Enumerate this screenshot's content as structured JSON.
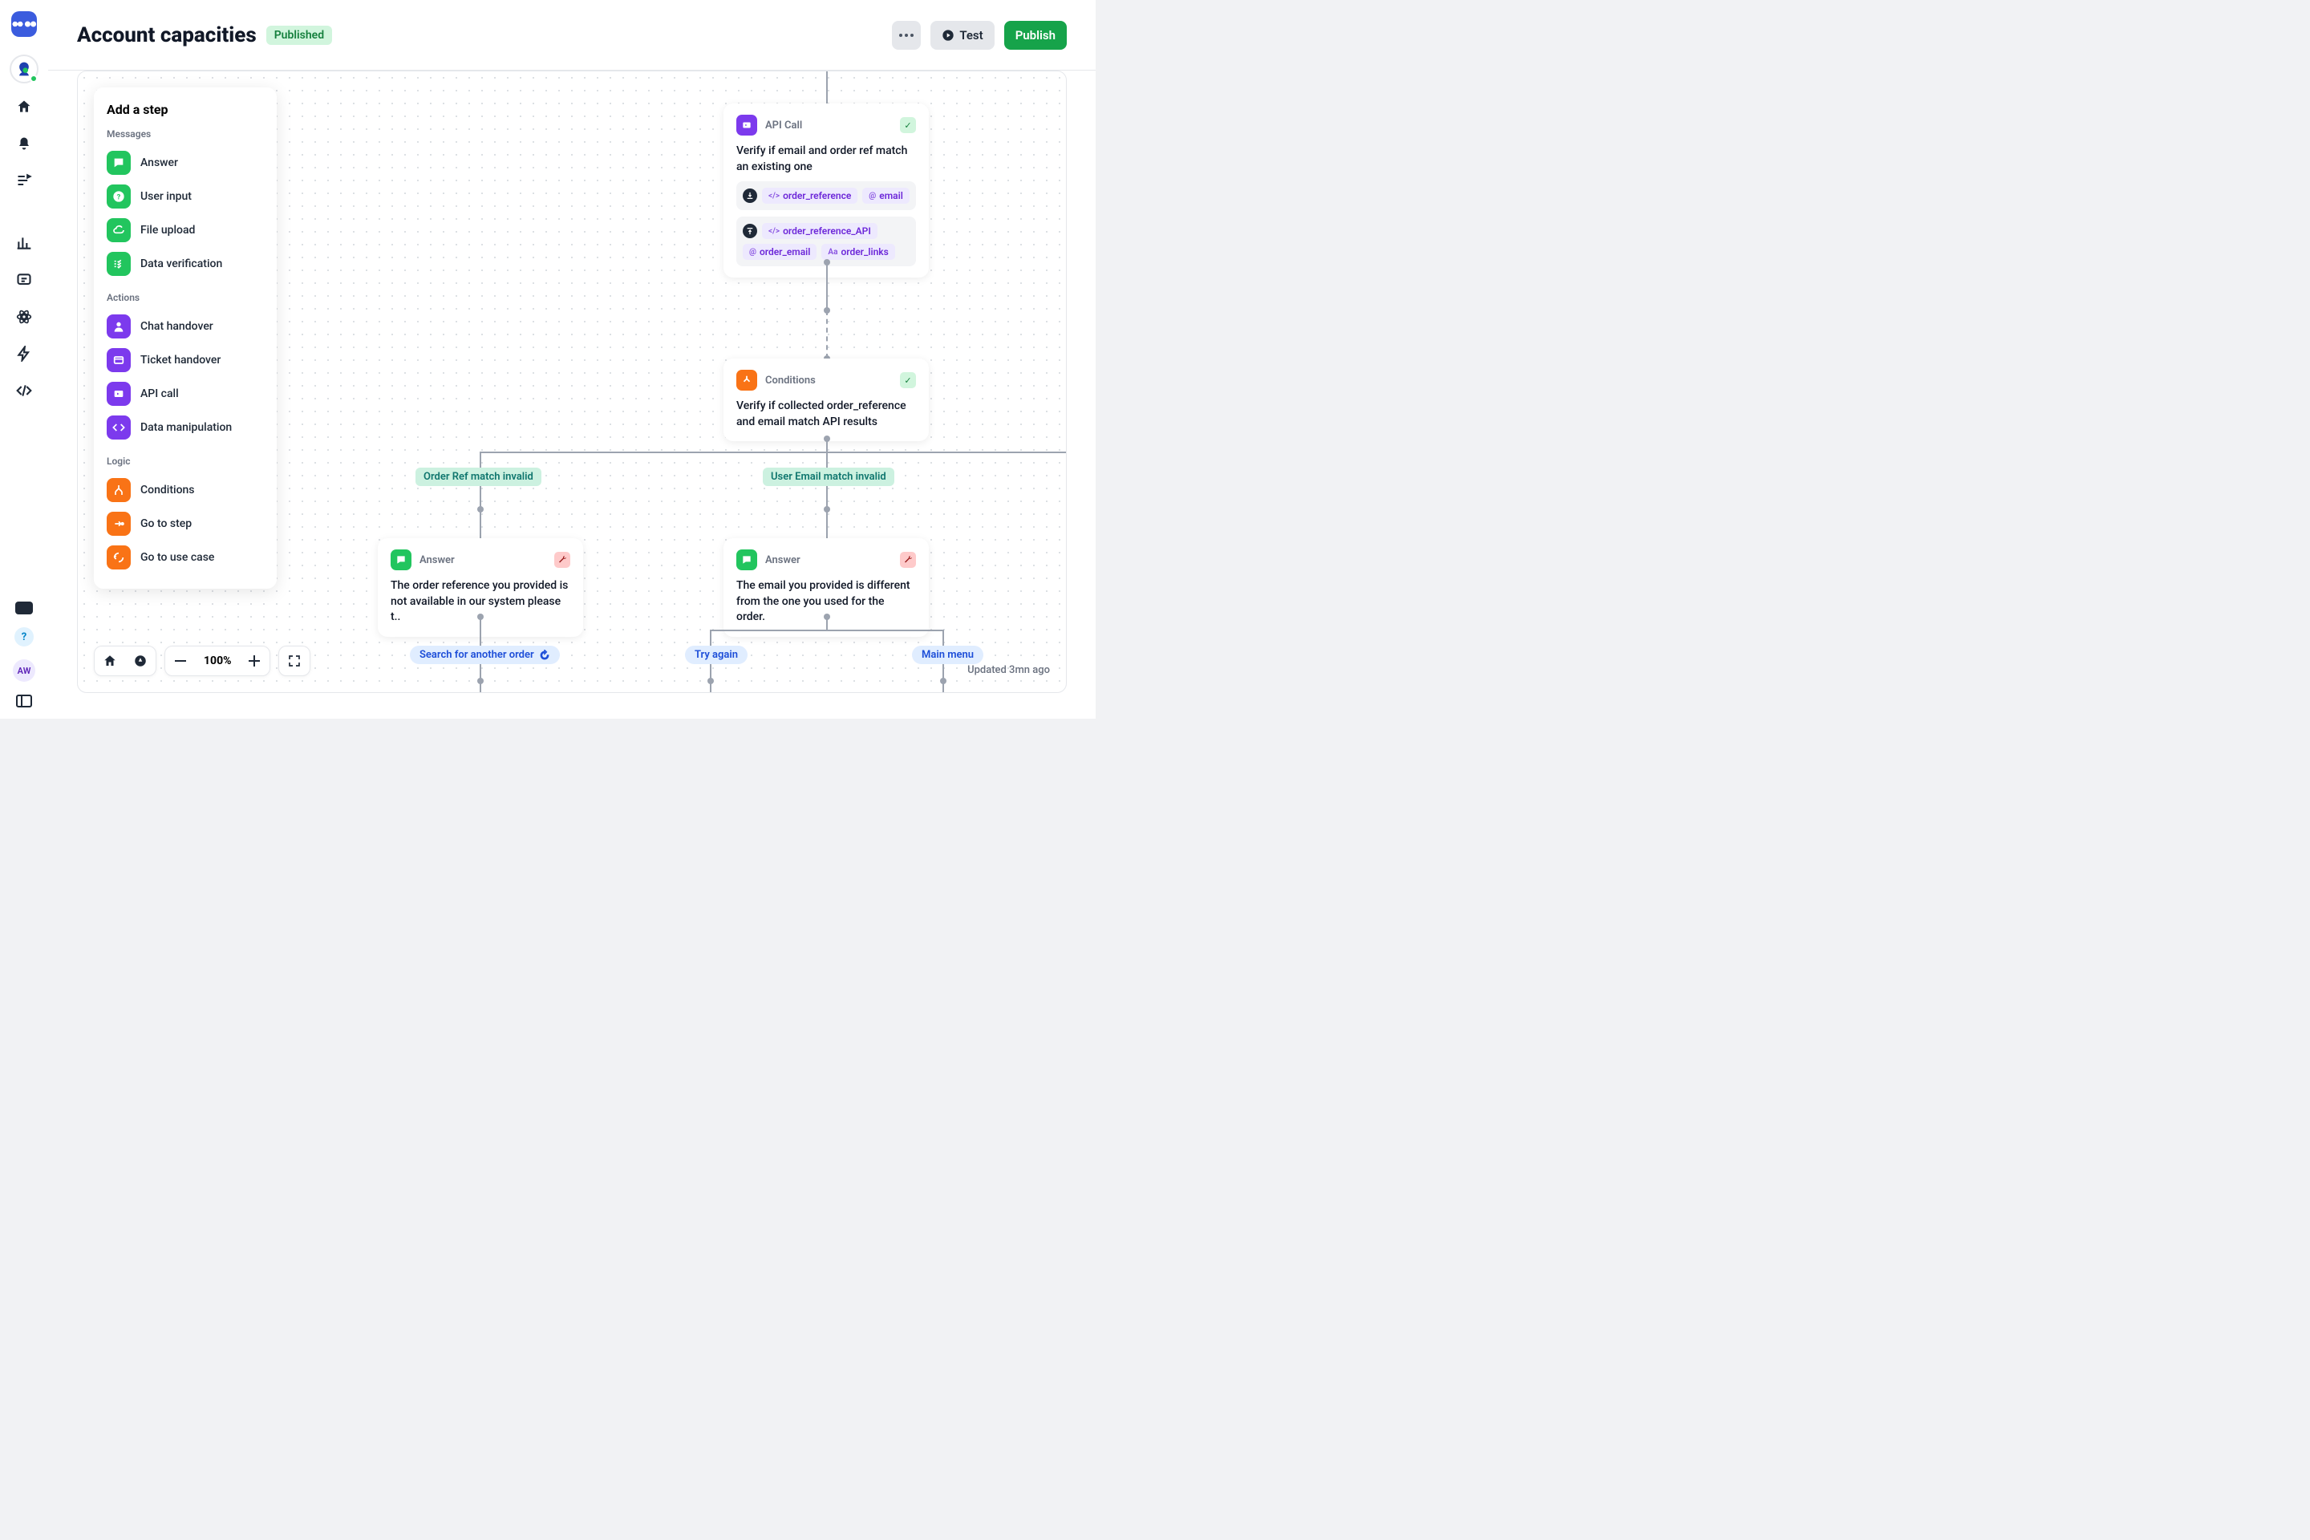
{
  "header": {
    "title": "Account capacities",
    "status": "Published",
    "test_label": "Test",
    "publish_label": "Publish"
  },
  "user_initials": "AW",
  "help_label": "?",
  "step_panel": {
    "title": "Add a step",
    "groups": [
      {
        "label": "Messages",
        "items": [
          "Answer",
          "User input",
          "File upload",
          "Data verification"
        ]
      },
      {
        "label": "Actions",
        "items": [
          "Chat handover",
          "Ticket handover",
          "API call",
          "Data manipulation"
        ]
      },
      {
        "label": "Logic",
        "items": [
          "Conditions",
          "Go to step",
          "Go to use case"
        ]
      }
    ]
  },
  "nodes": {
    "api_call": {
      "type": "API Call",
      "body": "Verify if email and order ref match an existing one",
      "inputs": [
        "order_reference",
        "email"
      ],
      "outputs": [
        "order_reference_API",
        "order_email",
        "order_links"
      ]
    },
    "conditions": {
      "type": "Conditions",
      "body": "Verify if collected order_reference and email match API results"
    },
    "answer_left": {
      "type": "Answer",
      "body": "The order reference you provided is not available in our system please t.."
    },
    "answer_right": {
      "type": "Answer",
      "body": "The email you provided is different from the one you used for the order."
    }
  },
  "cond_labels": {
    "left": "Order Ref match invalid",
    "right": "User Email match invalid"
  },
  "actions": {
    "search": "Search for another order",
    "try_again": "Try again",
    "main_menu": "Main menu"
  },
  "zoom": "100%",
  "updated": "Updated 3mn ago"
}
